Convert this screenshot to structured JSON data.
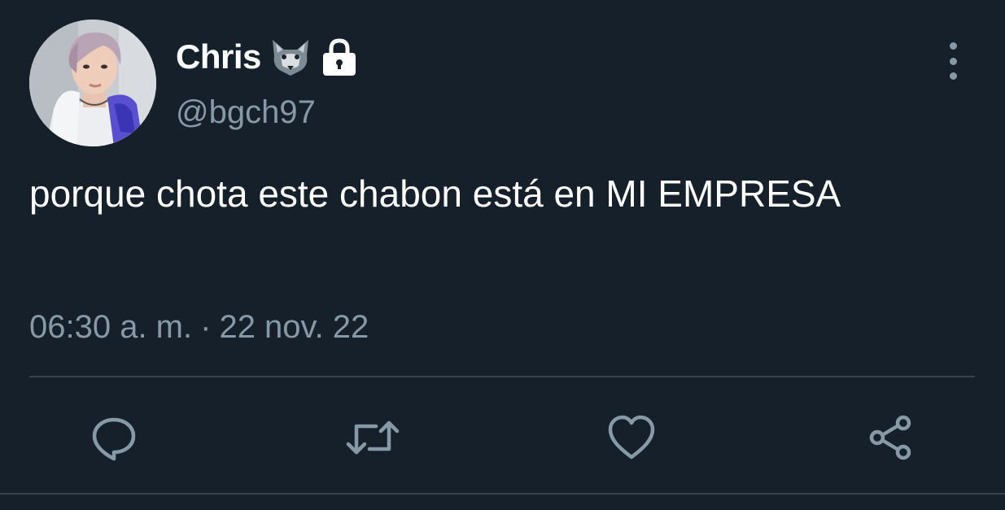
{
  "author": {
    "display_name": "Chris",
    "handle": "@bgch97"
  },
  "icons": {
    "name_badges": [
      "wolf-emoji-icon",
      "lock-icon"
    ],
    "more": "more-vertical-icon",
    "actions": [
      "reply-icon",
      "retweet-icon",
      "like-icon",
      "share-icon"
    ]
  },
  "tweet": {
    "text": "porque chota este chabon está en MI EMPRESA",
    "time": "06:30 a. m.",
    "separator": "·",
    "date": "22 nov. 22"
  },
  "colors": {
    "background": "#15202b",
    "text_primary": "#ffffff",
    "text_secondary": "#8899a6",
    "divider": "#38444d"
  }
}
